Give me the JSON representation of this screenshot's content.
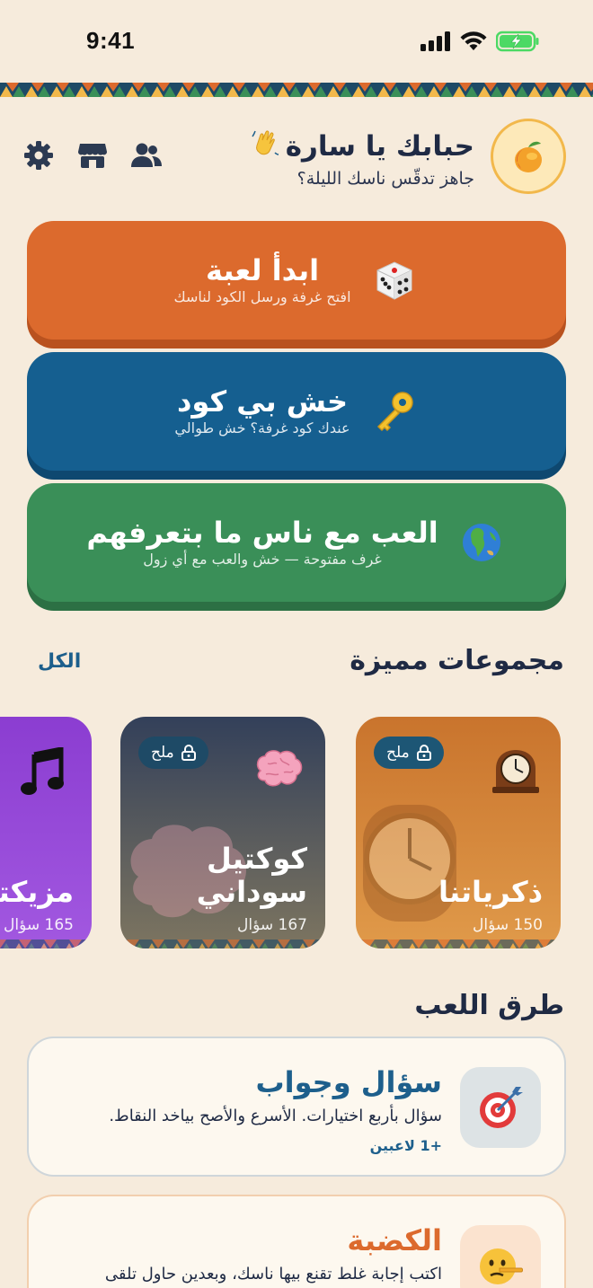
{
  "status_bar": {
    "time": "9:41"
  },
  "header": {
    "greeting": "حبابك يا سارة",
    "greeting_emoji": "waving-hand",
    "subtitle": "جاهز تدقّس ناسك الليلة؟",
    "avatar": "mango-icon",
    "icons": [
      "friends-icon",
      "store-icon",
      "settings-icon"
    ]
  },
  "actions": [
    {
      "title": "ابدأ لعبة",
      "subtitle": "افتح غرفة ورسل الكود لناسك",
      "icon": "dice-icon",
      "color": "#dc6a2d"
    },
    {
      "title": "خش بي كود",
      "subtitle": "عندك كود غرفة؟ خش طوالي",
      "icon": "key-icon",
      "color": "#155f90"
    },
    {
      "title": "العب مع ناس ما بتعرفهم",
      "subtitle": "غرف مفتوحة — خش والعب مع أي زول",
      "icon": "globe-icon",
      "color": "#3a8f58"
    }
  ],
  "collections": {
    "title": "مجموعات مميزة",
    "see_all": "الكل",
    "items": [
      {
        "name": "ذكرياتنا",
        "count": "150 سؤال",
        "badge": "ملح",
        "icon": "clock-icon"
      },
      {
        "name": "كوكتيل سوداني",
        "count": "167 سؤال",
        "badge": "ملح",
        "icon": "brain-icon"
      },
      {
        "name": "مزيكتنا",
        "count": "165 سؤال",
        "icon": "music-icon"
      }
    ]
  },
  "modes": {
    "title": "طرق اللعب",
    "items": [
      {
        "title": "سؤال وجواب",
        "desc": "سؤال بأربع اختيارات. الأسرع والأصح بياخد النقاط.",
        "players": "+1 لاعبين",
        "icon": "target-icon",
        "title_color": "#1d5f8c"
      },
      {
        "title": "الكضبة",
        "desc": "اكتب إجابة غلط تقنع بيها ناسك، وبعدين حاول تلقى",
        "icon": "lying-face-icon",
        "title_color": "#dc6a2d"
      }
    ]
  }
}
